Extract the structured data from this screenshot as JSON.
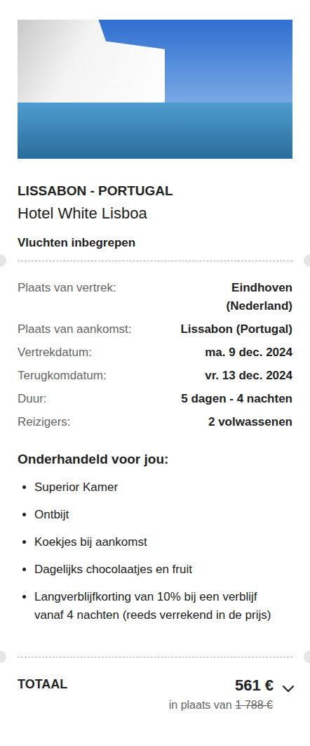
{
  "destination": "LISSABON - PORTUGAL",
  "hotel": "Hotel White Lisboa",
  "flights": "Vluchten inbegrepen",
  "details": [
    {
      "label": "Plaats van vertrek:",
      "value": "Eindhoven (Nederland)"
    },
    {
      "label": "Plaats van aankomst:",
      "value": "Lissabon (Portugal)"
    },
    {
      "label": "Vertrekdatum:",
      "value": "ma. 9 dec. 2024"
    },
    {
      "label": "Terugkomdatum:",
      "value": "vr. 13 dec. 2024"
    },
    {
      "label": "Duur:",
      "value": "5 dagen - 4 nachten"
    },
    {
      "label": "Reizigers:",
      "value": "2 volwassenen"
    }
  ],
  "perks": {
    "title": "Onderhandeld voor jou:",
    "items": [
      "Superior Kamer",
      "Ontbijt",
      "Koekjes bij aankomst",
      "Dagelijks chocolaatjes en fruit",
      "Langverblijfkorting van 10% bij een verblijf vanaf 4 nachten (reeds verrekend in de prijs)"
    ]
  },
  "total": {
    "label": "TOTAAL",
    "price": "561 €",
    "was_prefix": "in plaats van",
    "was_price": "1 788 €",
    "expanded": false
  }
}
